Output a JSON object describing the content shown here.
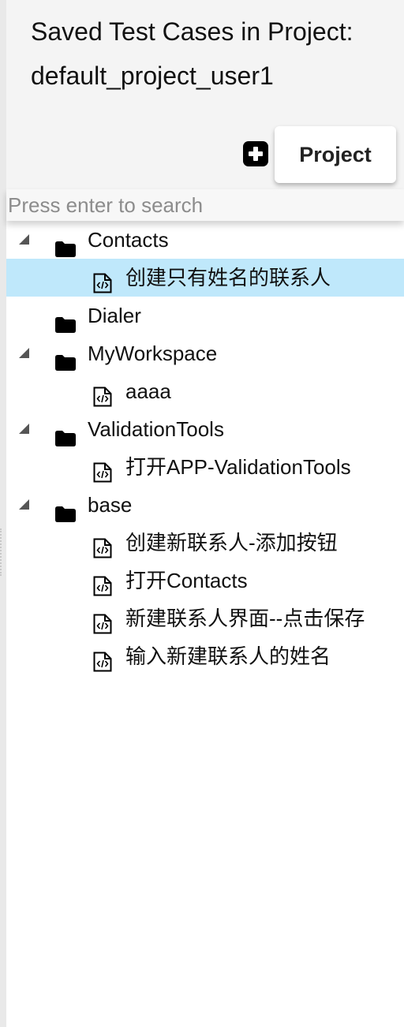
{
  "header": {
    "title_line1": "Saved Test Cases in Project:",
    "title_line2": "default_project_user1",
    "add_icon": "plus-square-icon",
    "project_button": "Project"
  },
  "search": {
    "placeholder": "Press enter to search",
    "value": ""
  },
  "colors": {
    "selected_row": "#bfe8fb",
    "header_bg": "#f4f4f4"
  },
  "tree": {
    "folders": [
      {
        "label": "Contacts",
        "expanded": true,
        "files": [
          {
            "label": "创建只有姓名的联系人",
            "selected": true
          }
        ]
      },
      {
        "label": "Dialer",
        "expanded": false,
        "files": []
      },
      {
        "label": "MyWorkspace",
        "expanded": true,
        "files": [
          {
            "label": "aaaa",
            "selected": false
          }
        ]
      },
      {
        "label": "ValidationTools",
        "expanded": true,
        "files": [
          {
            "label": "打开APP-ValidationTools",
            "selected": false
          }
        ]
      },
      {
        "label": "base",
        "expanded": true,
        "files": [
          {
            "label": "创建新联系人-添加按钮",
            "selected": false
          },
          {
            "label": "打开Contacts",
            "selected": false
          },
          {
            "label": "新建联系人界面--点击保存",
            "selected": false
          },
          {
            "label": "输入新建联系人的姓名",
            "selected": false
          }
        ]
      }
    ]
  }
}
